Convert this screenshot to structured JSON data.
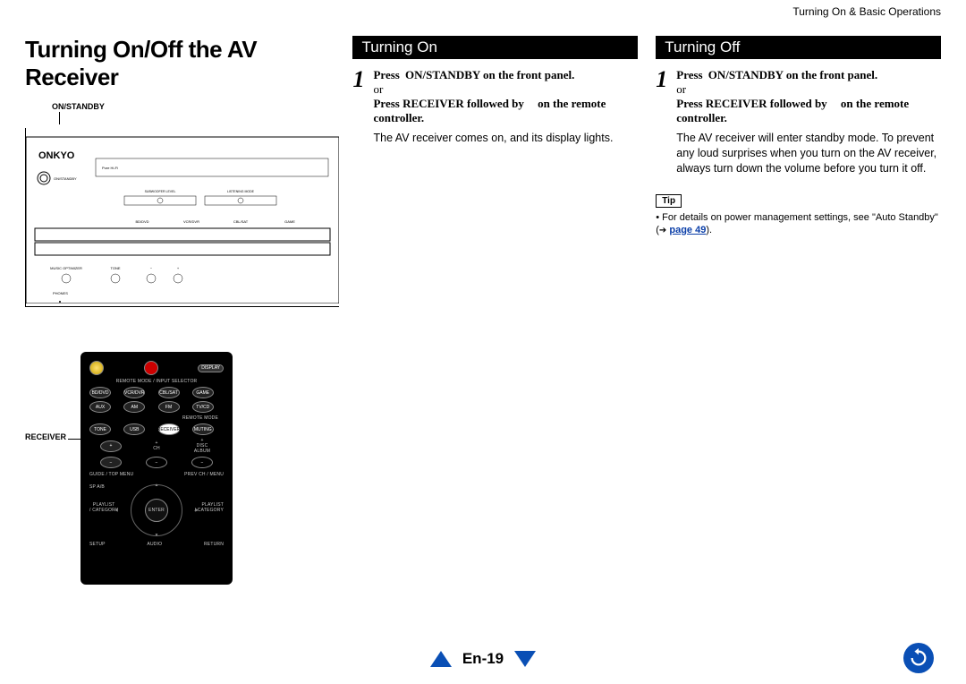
{
  "breadcrumb": "Turning On & Basic Operations",
  "main_title": "Turning On/Off the AV Receiver",
  "labels": {
    "on_standby": "ON/STANDBY",
    "receiver": "RECEIVER"
  },
  "panel": {
    "brand": "ONKYO",
    "standby_label": "ON/STANDBY",
    "controls": [
      "BD/DVD",
      "VCR/DVR",
      "CBL/SAT",
      "GAME"
    ],
    "row2": [
      "MUSIC OPTIMIZER",
      "TONE",
      "−",
      "+"
    ],
    "row3": [
      "PHONES"
    ],
    "dial1": "SUBWOOFER LEVEL",
    "dial2": "LISTENING MODE"
  },
  "remote": {
    "display": "DISPLAY",
    "selector_label": "REMOTE MODE / INPUT SELECTOR",
    "row1": [
      "BD/DVD",
      "VCR/DVR",
      "CBL/SAT",
      "GAME"
    ],
    "row2": [
      "AUX",
      "AM",
      "FM",
      "TV/CD"
    ],
    "mode_label": "REMOTE MODE",
    "row3": [
      "TONE",
      "USB",
      "RECEIVER",
      "MUTING"
    ],
    "vol_plus": "+",
    "vol_minus": "−",
    "ch": "CH",
    "disc": "DISC",
    "album": "ALBUM",
    "guide": "GUIDE / TOP MENU",
    "prev": "PREV CH / MENU",
    "spab": "SP A/B",
    "playlist_l": "PLAYLIST\n/ CATEGORY",
    "playlist_r": "PLAYLIST\n/ CATEGORY",
    "enter": "ENTER",
    "setup": "SETUP",
    "audio": "AUDIO",
    "return": "RETURN"
  },
  "sections": {
    "on": {
      "title": "Turning On",
      "step_num": "1",
      "line1_pre": "Press ",
      "line1_btn": "ON/STANDBY",
      "line1_post": " on the front panel.",
      "or": "or",
      "line2_pre": "Press ",
      "line2_b1": "RECEIVER",
      "line2_mid": " followed by ",
      "line2_post": " on the remote controller.",
      "body": "The AV receiver comes on, and its display lights."
    },
    "off": {
      "title": "Turning Off",
      "step_num": "1",
      "line1_pre": "Press ",
      "line1_btn": "ON/STANDBY",
      "line1_post": " on the front panel.",
      "or": "or",
      "line2_pre": "Press ",
      "line2_b1": "RECEIVER",
      "line2_mid": " followed by ",
      "line2_post": " on the remote controller.",
      "body": "The AV receiver will enter standby mode. To prevent any loud surprises when you turn on the AV receiver, always turn down the volume before you turn it off."
    }
  },
  "tip": {
    "label": "Tip",
    "bullet": "•",
    "text_pre": "For details on power management settings, see \"Auto Standby\" (",
    "arrow": "➔",
    "link": "page 49",
    "text_post": ")."
  },
  "footer": {
    "page": "En-19"
  }
}
